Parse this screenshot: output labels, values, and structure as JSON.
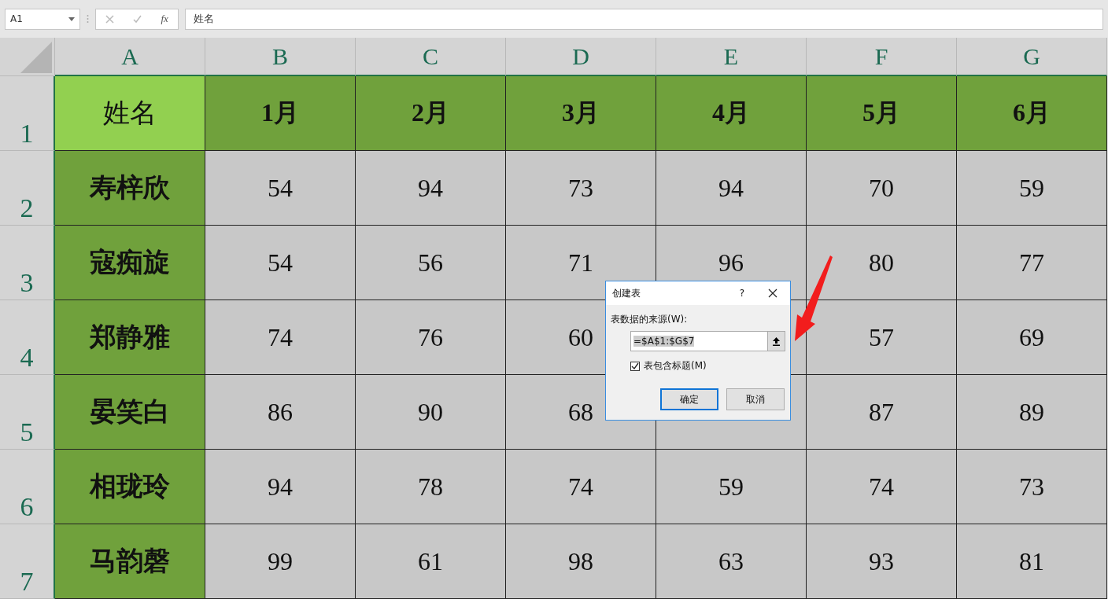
{
  "formula_bar": {
    "name_box": "A1",
    "fx": "fx",
    "formula": "姓名"
  },
  "columns": [
    "A",
    "B",
    "C",
    "D",
    "E",
    "F",
    "G"
  ],
  "rows": [
    {
      "number": "1",
      "kind": "header",
      "cells": [
        "姓名",
        "1月",
        "2月",
        "3月",
        "4月",
        "5月",
        "6月"
      ]
    },
    {
      "number": "2",
      "kind": "data",
      "cells": [
        "寿梓欣",
        "54",
        "94",
        "73",
        "94",
        "70",
        "59"
      ]
    },
    {
      "number": "3",
      "kind": "data",
      "cells": [
        "寇痴旋",
        "54",
        "56",
        "71",
        "96",
        "80",
        "77"
      ]
    },
    {
      "number": "4",
      "kind": "data",
      "cells": [
        "郑静雅",
        "74",
        "76",
        "60",
        null,
        "57",
        "69"
      ]
    },
    {
      "number": "5",
      "kind": "data",
      "cells": [
        "晏笑白",
        "86",
        "90",
        "68",
        null,
        "87",
        "89"
      ]
    },
    {
      "number": "6",
      "kind": "data",
      "cells": [
        "相珑玲",
        "94",
        "78",
        "74",
        "59",
        "74",
        "73"
      ]
    },
    {
      "number": "7",
      "kind": "data",
      "cells": [
        "马韵磬",
        "99",
        "61",
        "98",
        "63",
        "93",
        "81"
      ]
    }
  ],
  "dialog": {
    "title": "创建表",
    "help": "?",
    "label": "表数据的来源(W):",
    "range": "=$A$1:$G$7",
    "checkbox": {
      "label": "表包含标题(M)",
      "checked": true
    },
    "buttons": [
      {
        "label": "确定",
        "default": true
      },
      {
        "label": "取消",
        "default": false
      }
    ]
  }
}
